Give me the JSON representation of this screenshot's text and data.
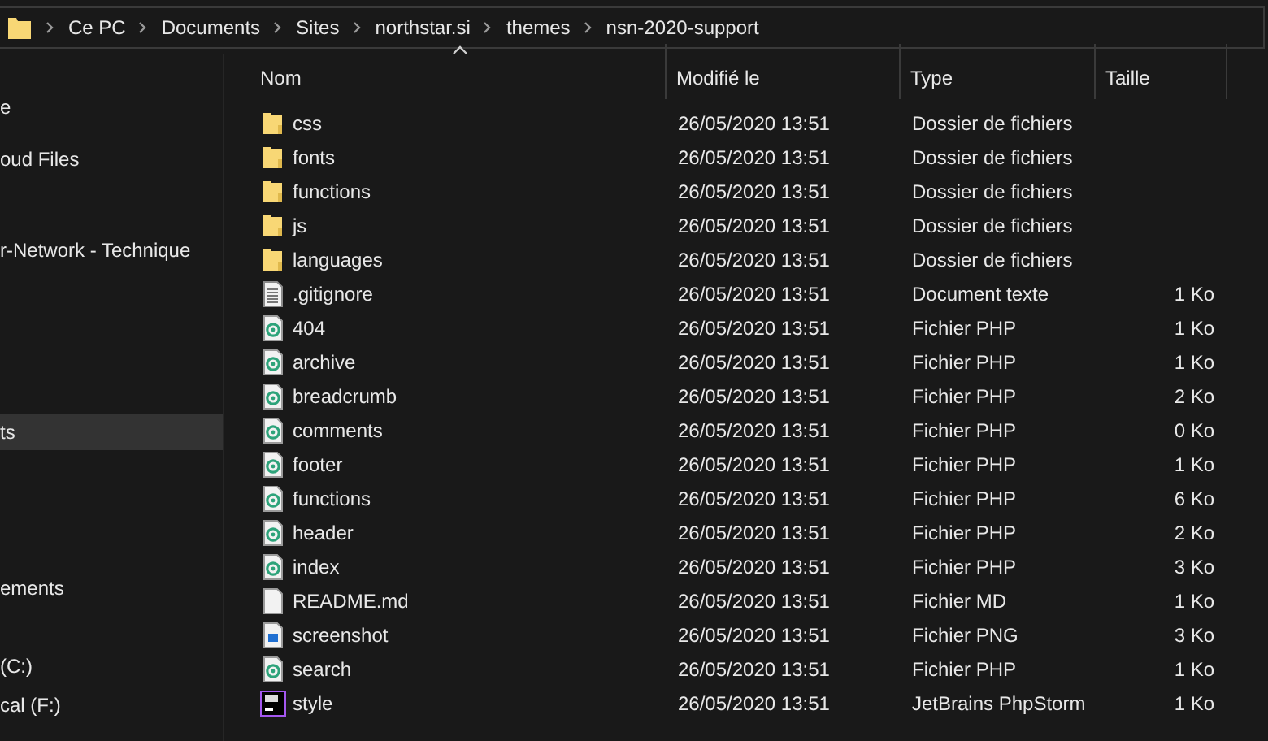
{
  "breadcrumb": [
    "Ce PC",
    "Documents",
    "Sites",
    "northstar.si",
    "themes",
    "nsn-2020-support"
  ],
  "sidebar": {
    "items": [
      {
        "label": "e",
        "selected": false
      },
      {
        "label": "oud Files",
        "selected": false
      },
      {
        "label": "r-Network - Technique",
        "selected": false
      },
      {
        "label": "ts",
        "selected": true
      },
      {
        "label": "ements",
        "selected": false
      },
      {
        "label": "(C:)",
        "selected": false
      },
      {
        "label": "cal (F:)",
        "selected": false
      }
    ]
  },
  "table": {
    "columns": [
      {
        "label": "Nom",
        "sorted": true
      },
      {
        "label": "Modifié le",
        "sorted": false
      },
      {
        "label": "Type",
        "sorted": false
      },
      {
        "label": "Taille",
        "sorted": false
      }
    ],
    "rows": [
      {
        "kind": "folder",
        "name": "css",
        "modified": "26/05/2020 13:51",
        "type": "Dossier de fichiers"
      },
      {
        "kind": "folder",
        "name": "fonts",
        "modified": "26/05/2020 13:51",
        "type": "Dossier de fichiers"
      },
      {
        "kind": "folder",
        "name": "functions",
        "modified": "26/05/2020 13:51",
        "type": "Dossier de fichiers"
      },
      {
        "kind": "folder",
        "name": "js",
        "modified": "26/05/2020 13:51",
        "type": "Dossier de fichiers"
      },
      {
        "kind": "folder",
        "name": "languages",
        "modified": "26/05/2020 13:51",
        "type": "Dossier de fichiers"
      },
      {
        "kind": "text",
        "name": ".gitignore",
        "modified": "26/05/2020 13:51",
        "type": "Document texte",
        "size": "1 Ko"
      },
      {
        "kind": "php",
        "name": "404",
        "modified": "26/05/2020 13:51",
        "type": "Fichier PHP",
        "size": "1 Ko"
      },
      {
        "kind": "php",
        "name": "archive",
        "modified": "26/05/2020 13:51",
        "type": "Fichier PHP",
        "size": "1 Ko"
      },
      {
        "kind": "php",
        "name": "breadcrumb",
        "modified": "26/05/2020 13:51",
        "type": "Fichier PHP",
        "size": "2 Ko"
      },
      {
        "kind": "php",
        "name": "comments",
        "modified": "26/05/2020 13:51",
        "type": "Fichier PHP",
        "size": "0 Ko"
      },
      {
        "kind": "php",
        "name": "footer",
        "modified": "26/05/2020 13:51",
        "type": "Fichier PHP",
        "size": "1 Ko"
      },
      {
        "kind": "php",
        "name": "functions",
        "modified": "26/05/2020 13:51",
        "type": "Fichier PHP",
        "size": "6 Ko"
      },
      {
        "kind": "php",
        "name": "header",
        "modified": "26/05/2020 13:51",
        "type": "Fichier PHP",
        "size": "2 Ko"
      },
      {
        "kind": "php",
        "name": "index",
        "modified": "26/05/2020 13:51",
        "type": "Fichier PHP",
        "size": "3 Ko"
      },
      {
        "kind": "md",
        "name": "README.md",
        "modified": "26/05/2020 13:51",
        "type": "Fichier MD",
        "size": "1 Ko"
      },
      {
        "kind": "png",
        "name": "screenshot",
        "modified": "26/05/2020 13:51",
        "type": "Fichier PNG",
        "size": "3 Ko"
      },
      {
        "kind": "php",
        "name": "search",
        "modified": "26/05/2020 13:51",
        "type": "Fichier PHP",
        "size": "1 Ko"
      },
      {
        "kind": "phpstorm",
        "name": "style",
        "modified": "26/05/2020 13:51",
        "type": "JetBrains PhpStorm",
        "size": "1 Ko"
      }
    ]
  }
}
